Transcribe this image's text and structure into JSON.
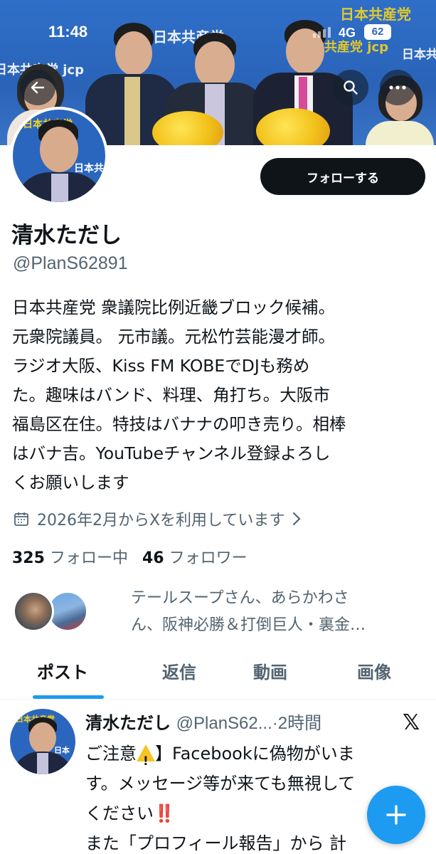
{
  "status_bar": {
    "time": "11:48",
    "network": "4G",
    "battery": "62"
  },
  "banner": {
    "wall_texts": [
      "日本共産党 jcp",
      "日本共産党",
      "日本共",
      "日本共産党 jcp"
    ]
  },
  "profile": {
    "follow_label": "フォローする",
    "display_name": "清水ただし",
    "handle": "@PlanS62891",
    "bio_lines": [
      "日本共産党 衆議院比例近畿ブロック候補。",
      "元衆院議員。 元市議。元松竹芸能漫才師。",
      "ラジオ大阪、Kiss FM KOBEでDJも務め",
      "た。趣味はバンド、料理、角打ち。大阪市",
      "福島区在住。特技はバナナの叩き売り。相棒",
      "はバナ吉。YouTubeチャンネル登録よろし",
      "くお願いします"
    ],
    "joined": "2026年2月からXを利用しています",
    "following_count": "325",
    "following_label": "フォロー中",
    "followers_count": "46",
    "followers_label": "フォロワー",
    "followed_by_lines": [
      "テールスープさん、あらかわさ",
      "ん、阪神必勝＆打倒巨人・裏金…"
    ]
  },
  "tabs": [
    {
      "label": "ポスト",
      "active": true
    },
    {
      "label": "返信",
      "active": false
    },
    {
      "label": "動画",
      "active": false
    },
    {
      "label": "画像",
      "active": false
    }
  ],
  "post": {
    "author": "清水ただし",
    "meta": "@PlanS62...·2時間",
    "line1_a": "ご注意",
    "line1_b": "】Facebookに偽物がいま",
    "line2": "す。メッセージ等が来ても無視して",
    "line3_a": "ください",
    "line3_b": "‼️",
    "line4": "また「プロフィール報告」から 計"
  },
  "colors": {
    "accent": "#1d9bf0",
    "text": "#0f1419",
    "secondary": "#536471"
  }
}
